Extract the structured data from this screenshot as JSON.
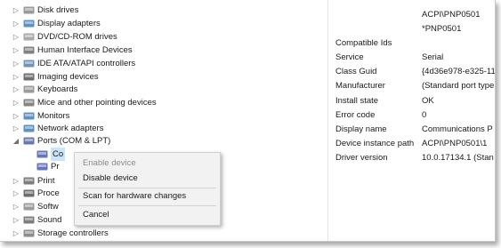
{
  "tree": {
    "items": [
      {
        "label": "Disk drives",
        "arrow": "▷",
        "icon": "disk-drive-icon",
        "color": "#8a8a8a"
      },
      {
        "label": "Display adapters",
        "arrow": "▷",
        "icon": "display-adapter-icon",
        "color": "#3c7fc1"
      },
      {
        "label": "DVD/CD-ROM drives",
        "arrow": "▷",
        "icon": "dvd-drive-icon",
        "color": "#9a9a9a"
      },
      {
        "label": "Human Interface Devices",
        "arrow": "▷",
        "icon": "hid-icon",
        "color": "#6b6b6b"
      },
      {
        "label": "IDE ATA/ATAPI controllers",
        "arrow": "▷",
        "icon": "ide-controller-icon",
        "color": "#5a7fa8"
      },
      {
        "label": "Imaging devices",
        "arrow": "▷",
        "icon": "camera-icon",
        "color": "#555555"
      },
      {
        "label": "Keyboards",
        "arrow": "▷",
        "icon": "keyboard-icon",
        "color": "#8a8a8a"
      },
      {
        "label": "Mice and other pointing devices",
        "arrow": "▷",
        "icon": "mouse-icon",
        "color": "#707070"
      },
      {
        "label": "Monitors",
        "arrow": "▷",
        "icon": "monitor-icon",
        "color": "#3c7fc1"
      },
      {
        "label": "Network adapters",
        "arrow": "▷",
        "icon": "network-adapter-icon",
        "color": "#3c7fc1"
      },
      {
        "label": "Ports (COM & LPT)",
        "arrow": "◢",
        "icon": "port-icon",
        "color": "#4a5fa8"
      },
      {
        "label": "Co",
        "arrow": "",
        "icon": "port-icon",
        "color": "#4a5fa8",
        "child": true,
        "selected": true
      },
      {
        "label": "Pr",
        "arrow": "",
        "icon": "port-icon",
        "color": "#4a5fa8",
        "child": true
      },
      {
        "label": "Print",
        "arrow": "▷",
        "icon": "printer-icon",
        "color": "#666666"
      },
      {
        "label": "Proce",
        "arrow": "▷",
        "icon": "processor-icon",
        "color": "#555555"
      },
      {
        "label": "Softw",
        "arrow": "▷",
        "icon": "software-device-icon",
        "color": "#8a8a8a"
      },
      {
        "label": "Sound",
        "arrow": "▷",
        "icon": "speaker-icon",
        "color": "#666666"
      },
      {
        "label": "Storage controllers",
        "arrow": "▷",
        "icon": "storage-controller-icon",
        "color": "#7a7a7a"
      }
    ]
  },
  "properties": {
    "rows": [
      {
        "key": "",
        "value": "ACPI\\PNP0501"
      },
      {
        "key": "",
        "value": "*PNP0501"
      },
      {
        "key": "Compatible Ids",
        "value": ""
      },
      {
        "key": "Service",
        "value": "Serial"
      },
      {
        "key": "Class Guid",
        "value": "{4d36e978-e325-11"
      },
      {
        "key": "Manufacturer",
        "value": "(Standard port type"
      },
      {
        "key": "Install state",
        "value": "OK"
      },
      {
        "key": "Error code",
        "value": "0"
      },
      {
        "key": "Display name",
        "value": "Communications P"
      },
      {
        "key": "Device instance path",
        "value": "ACPI\\PNP0501\\1"
      },
      {
        "key": "Driver version",
        "value": "10.0.17134.1    (Stan"
      }
    ]
  },
  "context_menu": {
    "enable_device": "Enable device",
    "disable_device": "Disable device",
    "scan_hardware": "Scan for hardware changes",
    "cancel": "Cancel"
  }
}
